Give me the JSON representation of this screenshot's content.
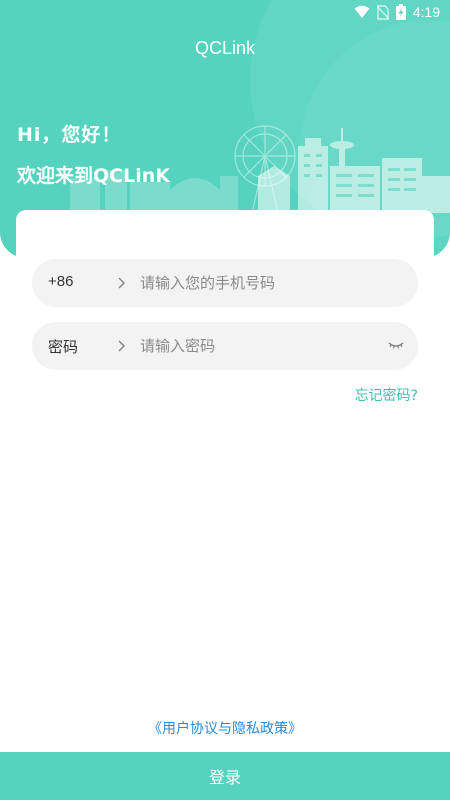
{
  "status_bar": {
    "time": "4:19",
    "icons": [
      "wifi-icon",
      "no-sim-icon",
      "battery-charging-icon"
    ]
  },
  "app": {
    "title": "QCLink"
  },
  "hero": {
    "greeting": "Hi，您好！",
    "welcome": "欢迎来到QCLinK",
    "illustration": "city-skyline-illustration"
  },
  "form": {
    "phone": {
      "prefix": "+86",
      "placeholder": "请输入您的手机号码",
      "value": ""
    },
    "password": {
      "label": "密码",
      "placeholder": "请输入密码",
      "value": ""
    },
    "forgot_label": "忘记密码?"
  },
  "agreement_label": "《用户协议与隐私政策》",
  "login_label": "登录",
  "colors": {
    "accent": "#55d3bf",
    "link": "#2a8ad8",
    "forgot": "#3fbfb0",
    "field_bg": "#f3f3f3"
  }
}
